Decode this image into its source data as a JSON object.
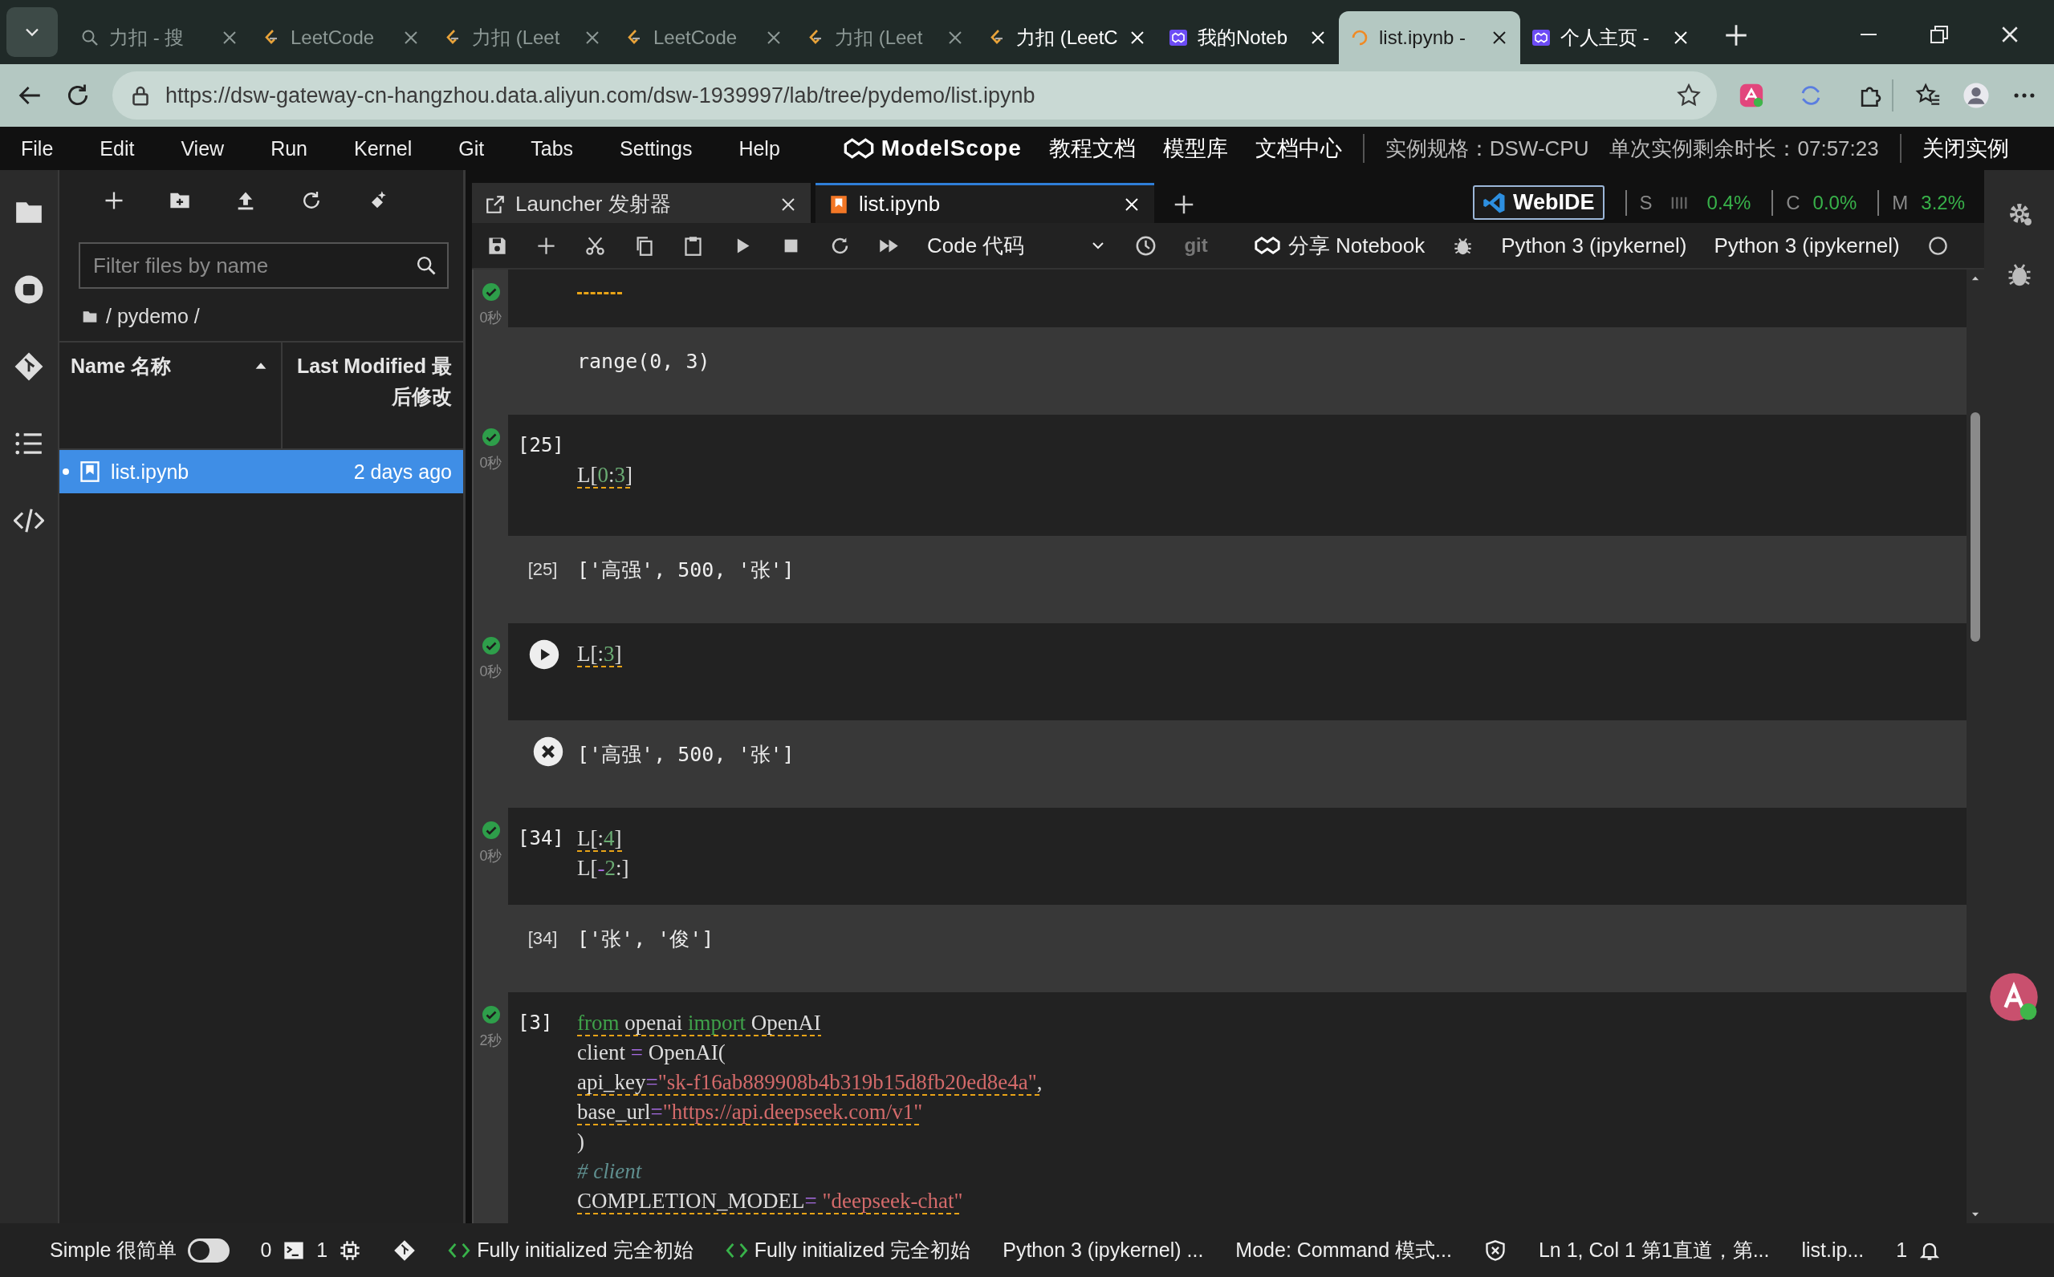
{
  "browser": {
    "tabs": [
      {
        "title": "力扣 - 搜",
        "kind": "search",
        "sleeping": true,
        "selected": false
      },
      {
        "title": "LeetCode",
        "kind": "leetcode",
        "sleeping": true,
        "selected": false
      },
      {
        "title": "力扣 (Leet",
        "kind": "leetcode",
        "sleeping": true,
        "selected": false
      },
      {
        "title": "LeetCode",
        "kind": "leetcode",
        "sleeping": true,
        "selected": false
      },
      {
        "title": "力扣 (Leet",
        "kind": "leetcode",
        "sleeping": true,
        "selected": false
      },
      {
        "title": "力扣 (LeetC",
        "kind": "leetcode",
        "sleeping": false,
        "selected": false
      },
      {
        "title": "我的Noteb",
        "kind": "modelscope",
        "sleeping": false,
        "selected": false
      },
      {
        "title": "list.ipynb -",
        "kind": "loading",
        "sleeping": false,
        "selected": true
      },
      {
        "title": "个人主页 -",
        "kind": "modelscope",
        "sleeping": false,
        "selected": false
      }
    ],
    "address": "https://dsw-gateway-cn-hangzhou.data.aliyun.com/dsw-1939997/lab/tree/pydemo/list.ipynb"
  },
  "menu": [
    "File",
    "Edit",
    "View",
    "Run",
    "Kernel",
    "Git",
    "Tabs",
    "Settings",
    "Help"
  ],
  "header": {
    "brand": "ModelScope",
    "links": [
      "教程文档",
      "模型库",
      "文档中心"
    ],
    "spec": "实例规格：DSW-CPU",
    "remaining": "单次实例剩余时长：07:57:23",
    "close": "关闭实例"
  },
  "file_browser": {
    "filter_placeholder": "Filter files by name",
    "path": "/ pydemo /",
    "columns": [
      {
        "label": "Name 名称",
        "sorted": true
      },
      {
        "label": "Last Modified 最后修改",
        "sorted": false
      }
    ],
    "rows": [
      {
        "name": "list.ipynb",
        "modified": "2 days ago",
        "selected": true
      }
    ]
  },
  "notebook_tabs": [
    {
      "label": "Launcher 发射器",
      "kind": "launcher",
      "selected": false
    },
    {
      "label": "list.ipynb",
      "kind": "notebook",
      "selected": true
    }
  ],
  "resources": {
    "webide": "WebIDE",
    "items": [
      {
        "label": "S",
        "value": "0.4%",
        "kind": "bars"
      },
      {
        "label": "C",
        "value": "0.0%",
        "kind": "plain"
      },
      {
        "label": "M",
        "value": "3.2%",
        "kind": "plain"
      }
    ]
  },
  "toolbar": {
    "cell_type": "Code 代码",
    "git": "git",
    "share": "分享 Notebook",
    "kernel": "Python 3 (ipykernel)",
    "kernel_name": "Python 3  (ipykernel)",
    "kernel_busy": false
  },
  "cells": [
    {
      "kind": "clipped",
      "done": true,
      "time": "0秒",
      "lint": true,
      "hover": false,
      "output": {
        "text": "range(0, 3)",
        "hover": false
      }
    },
    {
      "kind": "code",
      "done": true,
      "time": "0秒",
      "prompt": "[25]",
      "hover": false,
      "lines": [
        {
          "lint": false
        },
        {
          "lint": true,
          "tokens": [
            {
              "t": "L[",
              "kind": "plain"
            },
            {
              "t": "0",
              "kind": "num"
            },
            {
              "t": ":",
              "kind": "plain"
            },
            {
              "t": "3",
              "kind": "num"
            },
            {
              "t": "]",
              "kind": "plain"
            }
          ]
        },
        {
          "lint": false
        }
      ],
      "output": {
        "prompt": "[25]",
        "text": "['高强', 500, '张']",
        "hover": false
      }
    },
    {
      "kind": "code",
      "done": true,
      "time": "0秒",
      "hover": true,
      "lines": [
        {
          "lint": true,
          "tokens": [
            {
              "t": "L[:",
              "kind": "plain"
            },
            {
              "t": "3",
              "kind": "num"
            },
            {
              "t": "]",
              "kind": "plain"
            }
          ]
        }
      ],
      "output": {
        "text": "['高强', 500, '张']",
        "hover": true
      }
    },
    {
      "kind": "code",
      "done": true,
      "time": "0秒",
      "prompt": "[34]",
      "hover": false,
      "lines": [
        {
          "lint": true,
          "tokens": [
            {
              "t": "L[:",
              "kind": "plain"
            },
            {
              "t": "4",
              "kind": "num"
            },
            {
              "t": "]",
              "kind": "plain"
            }
          ]
        },
        {
          "lint": false,
          "tokens": [
            {
              "t": "L[",
              "kind": "plain"
            },
            {
              "t": "-",
              "kind": "op"
            },
            {
              "t": "2",
              "kind": "num"
            },
            {
              "t": ":]",
              "kind": "plain"
            }
          ]
        }
      ],
      "output": {
        "prompt": "[34]",
        "text": "['张', '俊']",
        "hover": false
      }
    },
    {
      "kind": "code",
      "done": true,
      "time": "2秒",
      "prompt": "[3]",
      "hover": false,
      "lines": [
        {
          "lint": true,
          "tokens": [
            {
              "t": "from",
              "kind": "kw"
            },
            {
              "t": " openai ",
              "kind": "plain"
            },
            {
              "t": "import",
              "kind": "kw"
            },
            {
              "t": " OpenAI",
              "kind": "plain"
            }
          ]
        },
        {
          "lint": false,
          "tokens": [
            {
              "t": "client ",
              "kind": "plain"
            },
            {
              "t": "=",
              "kind": "op"
            },
            {
              "t": " OpenAI(",
              "kind": "plain"
            }
          ]
        },
        {
          "lint": true,
          "tokens": [
            {
              "t": "api_key",
              "kind": "plain"
            },
            {
              "t": "=",
              "kind": "op"
            },
            {
              "t": "\"sk-f16ab889908b4b319b15d8fb20ed8e4a\"",
              "kind": "str"
            },
            {
              "t": ",",
              "kind": "plain"
            }
          ]
        },
        {
          "lint": true,
          "tokens": [
            {
              "t": "base_url",
              "kind": "plain"
            },
            {
              "t": "=",
              "kind": "op"
            },
            {
              "t": "\"https://api.deepseek.com/v1\"",
              "kind": "str"
            }
          ]
        },
        {
          "lint": false,
          "tokens": [
            {
              "t": ")",
              "kind": "plain"
            }
          ]
        },
        {
          "lint": false,
          "tokens": [
            {
              "t": "# client",
              "kind": "com"
            }
          ]
        },
        {
          "lint": true,
          "tokens": [
            {
              "t": "COMPLETION_MODEL",
              "kind": "plain"
            },
            {
              "t": "=",
              "kind": "op"
            },
            {
              "t": " \"deepseek-chat\"",
              "kind": "str"
            }
          ]
        }
      ]
    }
  ],
  "status_bar": {
    "simple_label": "Simple 很简单",
    "simple_on": false,
    "terminals": "0",
    "kernels": "1",
    "items": [
      "Fully initialized 完全初始",
      "Fully initialized 完全初始"
    ],
    "kernel": "Python 3 (ipykernel) ...",
    "mode": "Mode: Command 模式...",
    "position": "Ln 1, Col 1 第1直道，第...",
    "file": "list.ip...",
    "notifications": "1"
  }
}
